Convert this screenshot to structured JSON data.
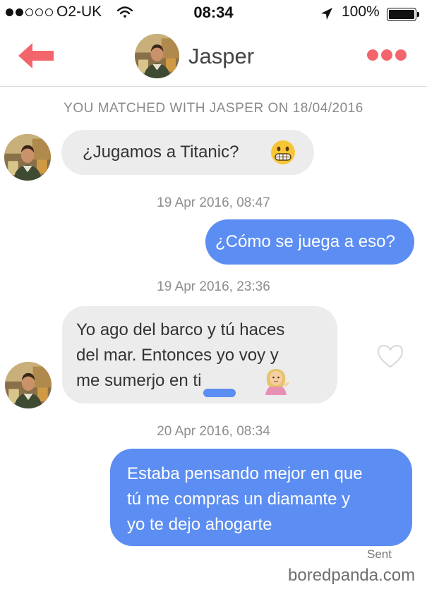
{
  "status_bar": {
    "carrier": "O2-UK",
    "time": "08:34",
    "battery": "100%",
    "signal_icon": "signal-dots-icon",
    "wifi_icon": "wifi-icon",
    "location_icon": "location-arrow-icon",
    "battery_icon": "battery-icon"
  },
  "header": {
    "name": "Jasper",
    "back_icon": "back-arrow-icon",
    "more_icon": "more-dots-icon",
    "accent_color": "#f2656b"
  },
  "conversation": {
    "match_banner": "YOU MATCHED WITH JASPER ON 18/04/2016",
    "messages": [
      {
        "from": "them",
        "text": "¿Jugamos a Titanic?",
        "emoji": "grimacing-face-emoji"
      },
      {
        "timestamp": "19 Apr 2016, 08:47"
      },
      {
        "from": "me",
        "text": "¿Cómo se juega a eso?"
      },
      {
        "timestamp": "19 Apr 2016, 23:36"
      },
      {
        "from": "them",
        "lines": [
          "Yo ago del barco y tú haces",
          "del mar. Entonces yo voy y",
          "me sumerjo en ti"
        ],
        "emoji": "person-tipping-hand-emoji",
        "like_icon": "heart-outline-icon"
      },
      {
        "timestamp": "20 Apr 2016, 08:34"
      },
      {
        "from": "me",
        "lines": [
          "Estaba pensando mejor en que",
          "tú me compras un diamante y",
          "yo te dejo ahogarte"
        ]
      }
    ],
    "sent_label": "Sent"
  },
  "colors": {
    "outgoing_bubble": "#5c8df2",
    "incoming_bubble": "#ececec",
    "background": "#ffffff"
  },
  "watermark": "boredpanda.com"
}
